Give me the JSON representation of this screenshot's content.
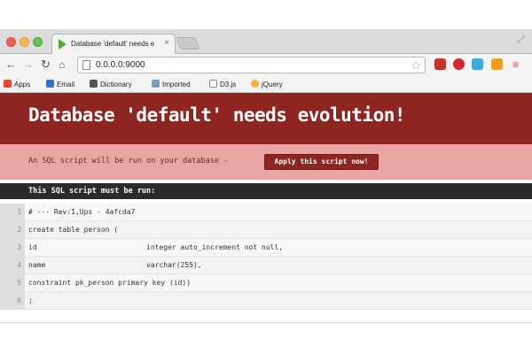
{
  "browser": {
    "tab_title": "Database 'default' needs e",
    "tab_close": "×",
    "url": "0.0.0.0:9000",
    "bookmarks": [
      {
        "label": "Apps",
        "icon": "apps-grid-icon",
        "color": "#e5482e"
      },
      {
        "label": "Email",
        "icon": "email-icon",
        "color": "#3d6fc4"
      },
      {
        "label": "Dictionary",
        "icon": "dictionary-icon",
        "color": "#555555"
      },
      {
        "label": "Imported",
        "icon": "folder-icon",
        "color": "#7a9cc6"
      },
      {
        "label": "D3.js",
        "icon": "page-icon",
        "color": "#ffffff"
      },
      {
        "label": "jQuery",
        "icon": "jquery-icon",
        "color": "#f5b52e"
      }
    ],
    "extension_colors": [
      "#c8332a",
      "#d8262f",
      "#3fa9dc",
      "#f39c1f",
      "#d9302b"
    ]
  },
  "page": {
    "heading": "Database 'default' needs evolution!",
    "notice": "An SQL script will be run on your database -",
    "apply_button": "Apply this script now!",
    "sql_header": "This SQL script must be run:",
    "code_lines": [
      {
        "n": "1",
        "a": "# --- Rev:1,Ups - 4afcda7",
        "b": ""
      },
      {
        "n": "2",
        "a": "create table person (",
        "b": ""
      },
      {
        "n": "3",
        "a": "id",
        "b": "integer auto_increment not null,"
      },
      {
        "n": "4",
        "a": "name",
        "b": "varchar(255),"
      },
      {
        "n": "5",
        "a": "constraint pk_person primary key (id))",
        "b": ""
      },
      {
        "n": "6",
        "a": ";",
        "b": ""
      }
    ]
  },
  "colors": {
    "banner": "#8f2520",
    "notice": "#eba4a4",
    "sql_header": "#2b2b2b"
  }
}
